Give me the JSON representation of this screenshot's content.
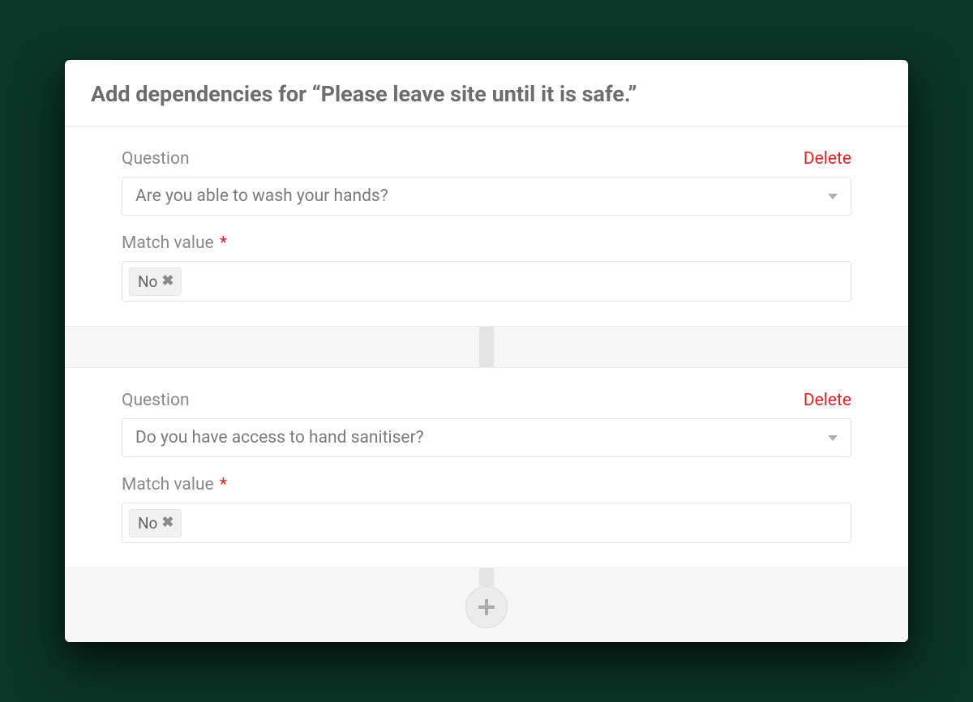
{
  "header": {
    "title": "Add dependencies for “Please leave site until it is safe.”"
  },
  "labels": {
    "question": "Question",
    "match_value": "Match value",
    "delete": "Delete"
  },
  "dependencies": [
    {
      "question": "Are you able to wash your hands?",
      "match_values": [
        "No"
      ]
    },
    {
      "question": "Do you have access to hand sanitiser?",
      "match_values": [
        "No"
      ]
    }
  ],
  "icons": {
    "add": "plus-icon",
    "caret": "caret-down-icon",
    "remove_tag": "close-icon"
  },
  "colors": {
    "danger": "#e02424",
    "text_muted": "#888888",
    "title": "#6d6d6d"
  }
}
